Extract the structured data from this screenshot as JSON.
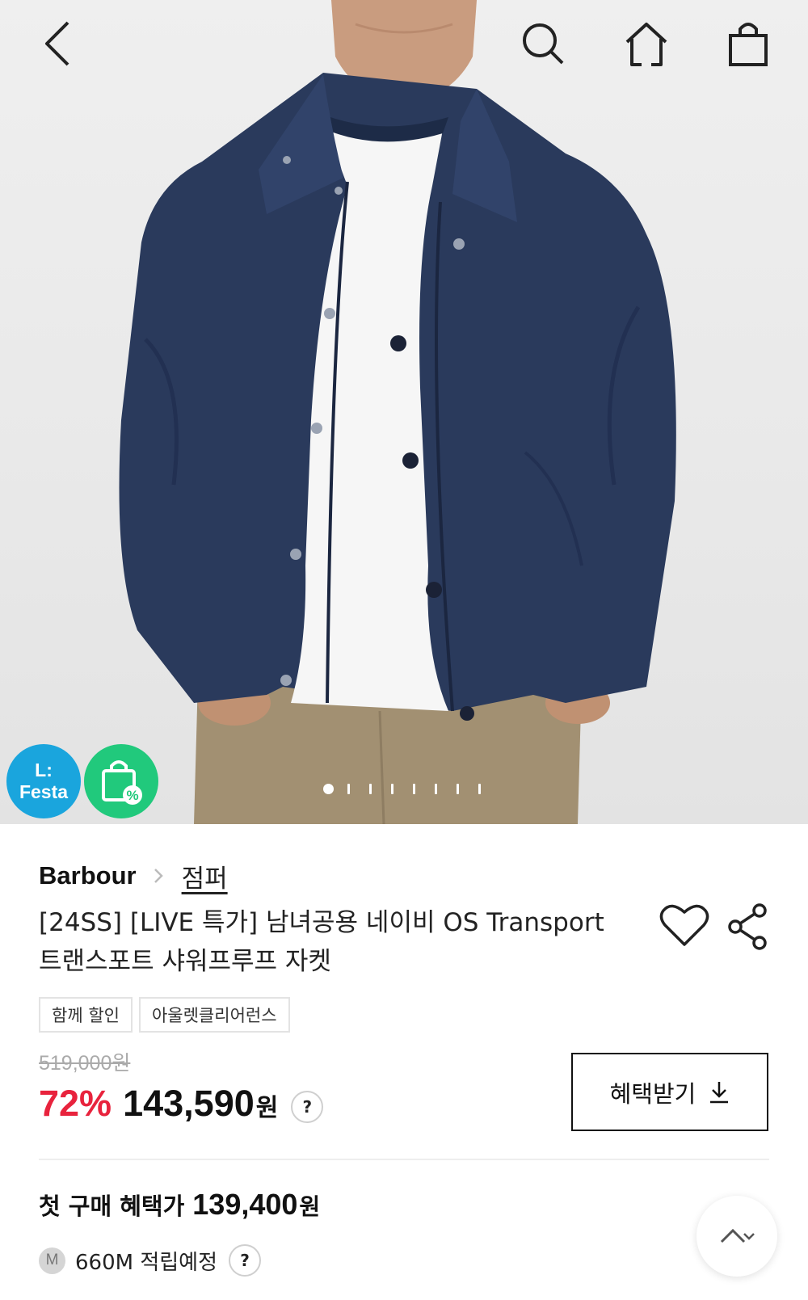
{
  "header": {
    "back_icon": "chevron-left-icon",
    "search_icon": "search-icon",
    "home_icon": "home-icon",
    "cart_icon": "shopping-bag-icon"
  },
  "gallery": {
    "badge_festa_line1": "L:",
    "badge_festa_line2": "Festa",
    "badge_festa_color": "#1aa5dd",
    "badge_sale_color": "#21c97c",
    "badge_sale_icon": "bag-percent-icon",
    "page_count": 8,
    "current_page": 1
  },
  "product": {
    "brand": "Barbour",
    "category": "점퍼",
    "title_line1": "[24SS] [LIVE 특가] 남녀공용 네이비 OS Transport",
    "title_line2": "트랜스포트 샤워프루프 자켓",
    "tags": [
      "함께 할인",
      "아울렛클리어런스"
    ],
    "original_price": "519,000원",
    "discount_rate": "72%",
    "price": "143,590",
    "price_unit": "원",
    "price_help": "?",
    "benefit_button": "혜택받기",
    "first_purchase_label": "첫 구매 혜택가",
    "first_purchase_price": "139,400",
    "first_purchase_unit": "원",
    "points_badge": "M",
    "points_text": "660M 적립예정",
    "points_help": "?"
  },
  "colors": {
    "discount_red": "#e8233d",
    "text_dark": "#111111"
  }
}
